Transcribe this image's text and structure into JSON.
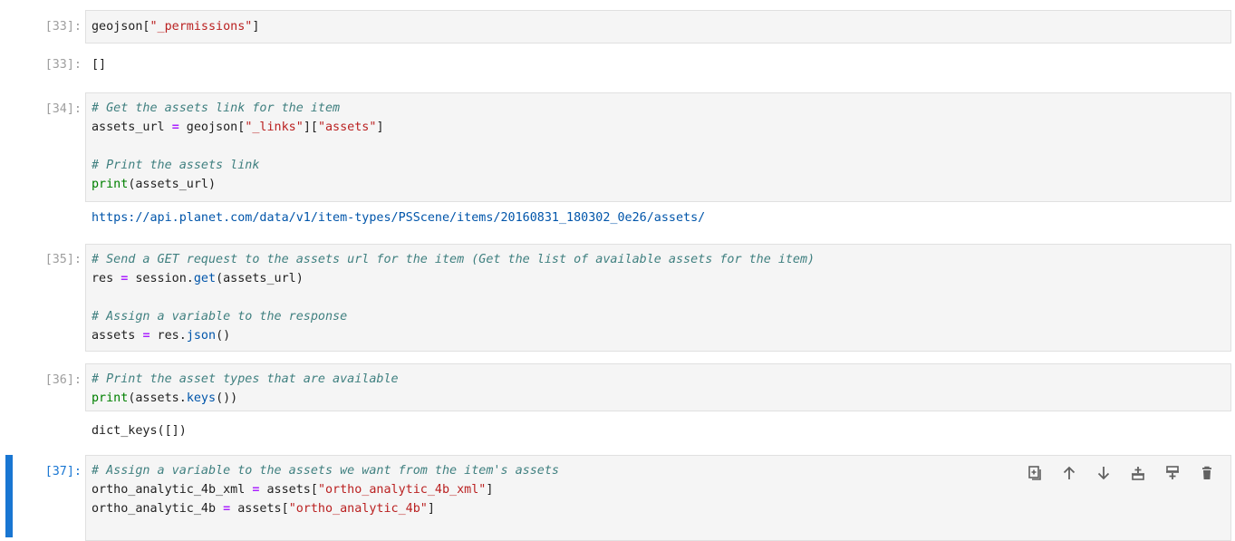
{
  "cells": [
    {
      "prompt": "[33]:",
      "input": [
        {
          "segments": [
            [
              "geojson[",
              ""
            ],
            [
              "\"_permissions\"",
              "str"
            ],
            [
              "]",
              ""
            ]
          ]
        }
      ],
      "output_prompt": "[33]:",
      "output": [
        "[]"
      ]
    },
    {
      "prompt": "[34]:",
      "input": [
        {
          "segments": [
            [
              "# Get the assets link for the item",
              "cm"
            ]
          ]
        },
        {
          "segments": [
            [
              "assets_url ",
              ""
            ],
            [
              "=",
              "op"
            ],
            [
              " geojson[",
              ""
            ],
            [
              "\"_links\"",
              "str"
            ],
            [
              "][",
              ""
            ],
            [
              "\"assets\"",
              "str"
            ],
            [
              "]",
              ""
            ]
          ]
        },
        {
          "segments": [
            [
              "",
              ""
            ]
          ]
        },
        {
          "segments": [
            [
              "# Print the assets link",
              "cm"
            ]
          ]
        },
        {
          "segments": [
            [
              "print",
              "bi"
            ],
            [
              "(assets_url)",
              ""
            ]
          ]
        }
      ],
      "output": [
        "https://api.planet.com/data/v1/item-types/PSScene/items/20160831_180302_0e26/assets/"
      ]
    },
    {
      "prompt": "[35]:",
      "input": [
        {
          "segments": [
            [
              "# Send a GET request to the assets url for the item (Get the list of available assets for the item)",
              "cm"
            ]
          ]
        },
        {
          "segments": [
            [
              "res ",
              ""
            ],
            [
              "=",
              "op"
            ],
            [
              " session.",
              ""
            ],
            [
              "get",
              "fn"
            ],
            [
              "(assets_url)",
              ""
            ]
          ]
        },
        {
          "segments": [
            [
              "",
              ""
            ]
          ]
        },
        {
          "segments": [
            [
              "# Assign a variable to the response",
              "cm"
            ]
          ]
        },
        {
          "segments": [
            [
              "assets ",
              ""
            ],
            [
              "=",
              "op"
            ],
            [
              " res.",
              ""
            ],
            [
              "json",
              "fn"
            ],
            [
              "()",
              ""
            ]
          ]
        }
      ]
    },
    {
      "prompt": "[36]:",
      "input": [
        {
          "segments": [
            [
              "# Print the asset types that are available",
              "cm"
            ]
          ]
        },
        {
          "segments": [
            [
              "print",
              "bi"
            ],
            [
              "(assets.",
              ""
            ],
            [
              "keys",
              "fn"
            ],
            [
              "())",
              ""
            ]
          ]
        }
      ],
      "output": [
        "dict_keys([])"
      ]
    },
    {
      "prompt": "[37]:",
      "input": [
        {
          "segments": [
            [
              "# Assign a variable to the assets we want from the item's assets",
              "cm"
            ]
          ]
        },
        {
          "segments": [
            [
              "ortho_analytic_4b_xml ",
              ""
            ],
            [
              "=",
              "op"
            ],
            [
              " assets[",
              ""
            ],
            [
              "\"ortho_analytic_4b_xml\"",
              "str"
            ],
            [
              "]",
              ""
            ]
          ]
        },
        {
          "segments": [
            [
              "ortho_analytic_4b ",
              ""
            ],
            [
              "=",
              "op"
            ],
            [
              " assets[",
              ""
            ],
            [
              "\"ortho_analytic_4b\"",
              "str"
            ],
            [
              "]",
              ""
            ]
          ]
        }
      ]
    }
  ],
  "toolbar": {
    "icons": [
      "duplicate-icon",
      "move-up-icon",
      "move-down-icon",
      "insert-above-icon",
      "insert-below-icon",
      "delete-icon"
    ]
  },
  "colors": {
    "accent": "#1976d2",
    "comment": "#408080",
    "string": "#ba2121",
    "operator": "#aa22ff",
    "builtin": "#008000",
    "function": "#0055aa",
    "cell_background": "#f5f5f5"
  }
}
